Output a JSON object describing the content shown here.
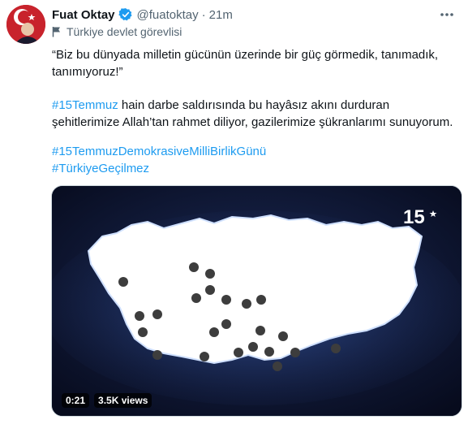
{
  "tweet": {
    "author_name": "Fuat Oktay",
    "handle": "@fuatoktay",
    "separator": "·",
    "time": "21m",
    "label": "Türkiye devlet görevlisi",
    "text_p1": "“Biz bu dünyada milletin gücünün üzerinde bir güç görmedik, tanımadık, tanımıyoruz!”",
    "p2_tag": "#15Temmuz",
    "p2_rest": " hain darbe saldırısında bu hayâsız akını durduran şehitlerimize Allah’tan rahmet diliyor, gazilerimize şükranlarımı sunuyorum.",
    "tag1": "#15TemmuzDemokrasiveMilliBirlikGünü",
    "tag2": "#TürkiyeGeçilmez"
  },
  "media": {
    "duration": "0:21",
    "views": "3.5K views",
    "logo_text": "15"
  },
  "colors": {
    "link": "#1d9bf0",
    "secondary": "#536471",
    "media_bg": "#0b1027",
    "verified": "#1d9bf0"
  },
  "icons": [
    "verified-badge-icon",
    "more-options-icon",
    "flag-icon",
    "avatar-turkish-flag"
  ]
}
